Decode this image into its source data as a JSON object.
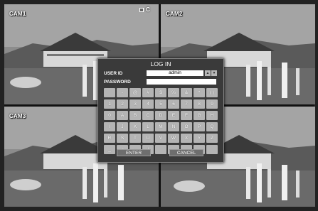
{
  "cameras": [
    {
      "label": "CAM1"
    },
    {
      "label": "CAM2"
    },
    {
      "label": "CAM3"
    },
    {
      "label": ""
    }
  ],
  "rec_indicator": "C",
  "login": {
    "title": "LOG IN",
    "user_id_label": "USER ID",
    "user_id_value": "admin",
    "password_label": "PASSWORD",
    "spin_up": "▲",
    "spin_down": "▼",
    "keys": [
      "",
      "-",
      "@",
      "#",
      "$",
      "%",
      "&",
      "*",
      "( )",
      "1",
      "2",
      "3",
      "4",
      "5",
      "6",
      "7",
      "8",
      "9",
      "0",
      "A",
      "B",
      "C",
      "D",
      "E",
      "F",
      "G",
      "H",
      "I",
      "J",
      "K",
      "L",
      "M",
      "N",
      "O",
      "P",
      "Q",
      "R",
      "S",
      "T",
      "U",
      "V",
      "W",
      "X",
      "Y",
      "Z",
      "_",
      "a",
      "←",
      "/",
      "",
      "",
      "",
      "",
      ""
    ],
    "enter_label": "ENTER",
    "cancel_label": "CANCEL"
  },
  "colors": {
    "dialog_bg": "#3a3a3a",
    "key_bg": "#b4b4b4",
    "sky": "#9a9a9a"
  }
}
